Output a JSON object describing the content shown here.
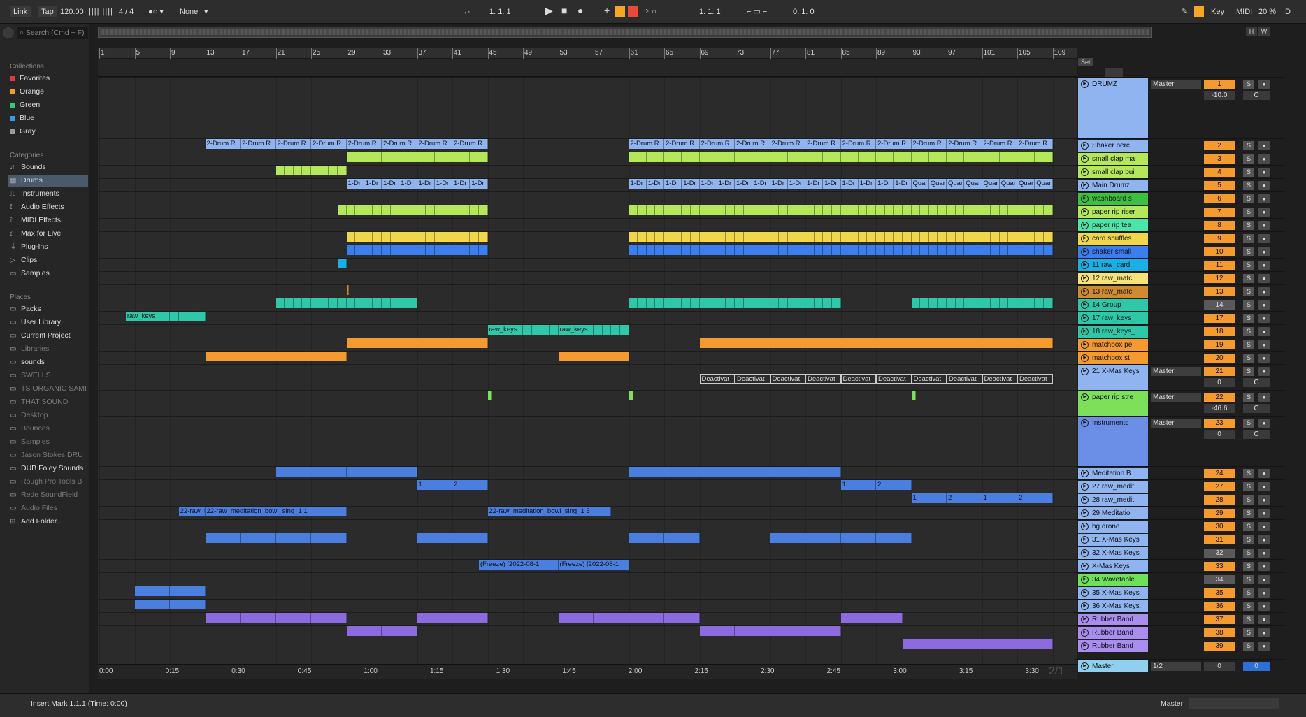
{
  "transport": {
    "link": "Link",
    "tap": "Tap",
    "tempo": "120.00",
    "meter": "4 / 4",
    "quant": "None",
    "pos": "1. 1. 1",
    "loop_start": "1. 1. 1",
    "loop_len": "0. 1. 0",
    "key": "Key",
    "midi": "MIDI",
    "cpu": "20 %",
    "d": "D"
  },
  "search": {
    "placeholder": "Search (Cmd + F)"
  },
  "browser": {
    "collections_head": "Collections",
    "collections": [
      {
        "label": "Favorites",
        "color": "#e53935"
      },
      {
        "label": "Orange",
        "color": "#f39c2f"
      },
      {
        "label": "Green",
        "color": "#2ecc71"
      },
      {
        "label": "Blue",
        "color": "#2e9fe6"
      },
      {
        "label": "Gray",
        "color": "#9a9a9a"
      }
    ],
    "categories_head": "Categories",
    "categories": [
      "Sounds",
      "Drums",
      "Instruments",
      "Audio Effects",
      "MIDI Effects",
      "Max for Live",
      "Plug-Ins",
      "Clips",
      "Samples"
    ],
    "places_head": "Places",
    "places": [
      {
        "label": "Packs",
        "dim": false
      },
      {
        "label": "User Library",
        "dim": false
      },
      {
        "label": "Current Project",
        "dim": false
      },
      {
        "label": "Libraries",
        "dim": true
      },
      {
        "label": "sounds",
        "dim": false
      },
      {
        "label": "SWELLS",
        "dim": true
      },
      {
        "label": "TS ORGANIC SAMI",
        "dim": true
      },
      {
        "label": "THAT SOUND",
        "dim": true
      },
      {
        "label": "Desktop",
        "dim": true
      },
      {
        "label": "Bounces",
        "dim": true
      },
      {
        "label": "Samples",
        "dim": true
      },
      {
        "label": "Jason Stokes DRU",
        "dim": true
      },
      {
        "label": "DUB Foley Sounds",
        "dim": false
      },
      {
        "label": "Rough Pro Tools B",
        "dim": true
      },
      {
        "label": "Rede SoundField",
        "dim": true
      },
      {
        "label": "Audio Files",
        "dim": true
      },
      {
        "label": "Add Folder...",
        "dim": false
      }
    ]
  },
  "ruler_bars": [
    "1",
    "5",
    "9",
    "13",
    "17",
    "21",
    "25",
    "29",
    "33",
    "37",
    "41",
    "45",
    "49",
    "53",
    "57",
    "61",
    "65",
    "69",
    "73",
    "77",
    "81",
    "85",
    "89",
    "93",
    "97",
    "101",
    "105",
    "109"
  ],
  "time_labels": [
    "0:00",
    "0:15",
    "0:30",
    "0:45",
    "1:00",
    "1:15",
    "1:30",
    "1:45",
    "2:00",
    "2:15",
    "2:30",
    "2:45",
    "3:00",
    "3:15",
    "3:30"
  ],
  "set_label": "Set",
  "page_indicator": "2/1",
  "tracks": [
    {
      "name": "DRUMZ",
      "color": "#8fb4f0",
      "num": "1",
      "route": "Master",
      "vol": "-10.0",
      "pan": "C",
      "h": 88
    },
    {
      "name": "Shaker perc",
      "color": "#8fb4f0",
      "num": "2",
      "h": 19
    },
    {
      "name": "small clap ma",
      "color": "#b4e75a",
      "num": "3",
      "h": 19
    },
    {
      "name": "small clap bui",
      "color": "#b4e75a",
      "num": "4",
      "h": 19
    },
    {
      "name": "Main Drumz",
      "color": "#8fb4f0",
      "num": "5",
      "h": 19
    },
    {
      "name": "washboard s",
      "color": "#3fbf3f",
      "num": "6",
      "h": 19
    },
    {
      "name": "paper rip riser",
      "color": "#b4e75a",
      "num": "7",
      "h": 19
    },
    {
      "name": "paper rip tea",
      "color": "#48e6a8",
      "num": "8",
      "h": 19
    },
    {
      "name": "card shuffles",
      "color": "#f0d64a",
      "num": "9",
      "h": 19
    },
    {
      "name": "shaker small",
      "color": "#3a7ef0",
      "num": "10",
      "h": 19
    },
    {
      "name": "11 raw_card",
      "color": "#1ab0e6",
      "num": "11",
      "h": 19
    },
    {
      "name": "12 raw_matc",
      "color": "#f5e37a",
      "num": "12",
      "h": 19
    },
    {
      "name": "13 raw_matc",
      "color": "#d08a30",
      "num": "13",
      "h": 19
    },
    {
      "name": "14 Group",
      "color": "#2ec7a8",
      "num": "14",
      "h": 19
    },
    {
      "name": "17 raw_keys_",
      "color": "#2ec7a8",
      "num": "17",
      "h": 19
    },
    {
      "name": "18 raw_keys_",
      "color": "#2ec7a8",
      "num": "18",
      "h": 19
    },
    {
      "name": "matchbox pe",
      "color": "#f49a2f",
      "num": "19",
      "h": 19
    },
    {
      "name": "matchbox st",
      "color": "#f49a2f",
      "num": "20",
      "h": 19
    },
    {
      "name": "21 X-Mas Keys",
      "color": "#8fb4f0",
      "num": "21",
      "route": "Master",
      "vol": "0",
      "pan": "C",
      "h": 37
    },
    {
      "name": "paper rip stre",
      "color": "#7de05a",
      "num": "22",
      "route": "Master",
      "vol": "-46.6",
      "pan": "C",
      "h": 37
    },
    {
      "name": "Instruments",
      "color": "#6b8fe6",
      "num": "23",
      "route": "Master",
      "vol": "0",
      "pan": "C",
      "h": 72
    },
    {
      "name": "Meditation B",
      "color": "#8fb4f0",
      "num": "24",
      "h": 19
    },
    {
      "name": "27 raw_medit",
      "color": "#8fb4f0",
      "num": "27",
      "h": 19
    },
    {
      "name": "28 raw_medit",
      "color": "#8fb4f0",
      "num": "28",
      "h": 19
    },
    {
      "name": "29 Meditatio",
      "color": "#8fb4f0",
      "num": "29",
      "h": 19
    },
    {
      "name": "bg drone",
      "color": "#8fb4f0",
      "num": "30",
      "h": 19
    },
    {
      "name": "31 X-Mas Keys",
      "color": "#8fb4f0",
      "num": "31",
      "h": 19
    },
    {
      "name": "32 X-Mas Keys",
      "color": "#8fb4f0",
      "num": "32",
      "h": 19
    },
    {
      "name": "X-Mas Keys",
      "color": "#8fb4f0",
      "num": "33",
      "h": 19
    },
    {
      "name": "34 Wavetable",
      "color": "#6ee05a",
      "num": "34",
      "h": 19
    },
    {
      "name": "35 X-Mas Keys",
      "color": "#8fb4f0",
      "num": "35",
      "h": 19
    },
    {
      "name": "36 X-Mas Keys",
      "color": "#8fb4f0",
      "num": "36",
      "h": 19
    },
    {
      "name": "Rubber Band",
      "color": "#a98ef0",
      "num": "37",
      "h": 19
    },
    {
      "name": "Rubber Band",
      "color": "#a98ef0",
      "num": "38",
      "h": 19
    },
    {
      "name": "Rubber Band",
      "color": "#a98ef0",
      "num": "39",
      "h": 19
    }
  ],
  "master": {
    "name": "Master",
    "route": "1/2",
    "vol": "0",
    "pan": "0"
  },
  "status": {
    "text": "Insert Mark 1.1.1 (Time: 0:00)",
    "master": "Master"
  },
  "clip_labels": {
    "drum_rack": "2-Drum R",
    "one_dr": "1-Dr",
    "quar": "Quar",
    "raw_keys": "raw_keys",
    "raw_medit_a": "22-raw_meditation_bowl_sing_1 1",
    "raw_medit_b": "22-raw_meditation_bowl_sing_1 5",
    "freeze": "(Freeze) [2022-08-1",
    "deact": "Deactivat",
    "one": "1",
    "two": "2"
  },
  "overview_buttons": [
    "H",
    "W"
  ]
}
